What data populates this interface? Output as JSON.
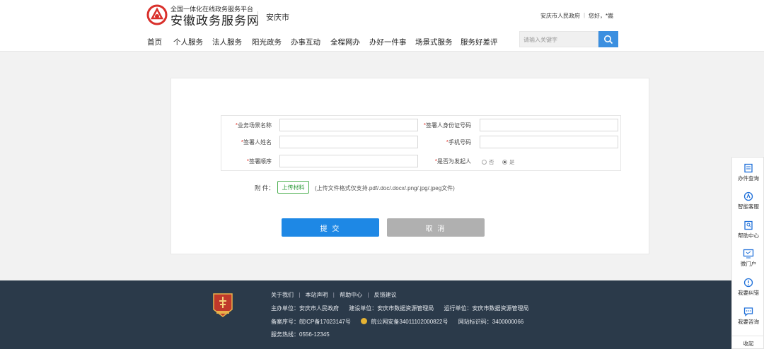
{
  "header": {
    "logo_subtitle": "全国一体化在线政务服务平台",
    "logo_title": "安徽政务服务网",
    "city": "安庆市",
    "gov_link": "安庆市人民政府",
    "separator": "|",
    "greeting": "您好，*嵩",
    "nav": [
      "首页",
      "个人服务",
      "法人服务",
      "阳光政务",
      "办事互动",
      "全程网办",
      "办好一件事",
      "场景式服务",
      "服务好差评"
    ],
    "search_placeholder": "请输入关键字"
  },
  "form": {
    "required_mark": "*",
    "fields": {
      "scene_name": "业务场景名称",
      "signer_id": "签署人身份证号码",
      "signer_name": "签署人姓名",
      "phone": "手机号码",
      "sign_order": "签署顺序",
      "is_initiator": "是否为发起人"
    },
    "radio_no": "否",
    "radio_yes": "是",
    "radio_selected": "是",
    "attachment_label": "附 件：",
    "upload_button": "上传材料",
    "upload_hint": "(上传文件格式仅支持.pdf/.doc/.docx/.png/.jpg/.jpeg文件)",
    "submit_button": "提 交",
    "cancel_button": "取 消"
  },
  "footer": {
    "links": [
      "关于我们",
      "本站声明",
      "帮助中心",
      "反馈建议"
    ],
    "link_sep": "|",
    "sponsor": "主办单位：安庆市人民政府",
    "builder": "建设单位：安庆市数据资源管理局",
    "operator": "运行单位：安庆市数据资源管理局",
    "icp": "备案序号：皖ICP备17023147号",
    "police": "皖公网安备34011102000822号",
    "site_code": "网站标识码：3400000066",
    "hotline": "服务热线：0556-12345"
  },
  "sidebar": {
    "items": [
      "办件查询",
      "智能客服",
      "帮助中心",
      "微门户",
      "我要纠错",
      "我要咨询"
    ],
    "close": "收起"
  },
  "colors": {
    "brand_red": "#d9302b",
    "primary_blue": "#1e88e5",
    "footer_bg": "#2b3a4a",
    "upload_green": "#2e9a3a"
  },
  "icons": [
    "logo-mark",
    "search-icon",
    "gov-badge",
    "police-badge",
    "query-icon",
    "service-icon",
    "help-icon",
    "portal-icon",
    "correction-icon",
    "consult-icon"
  ]
}
